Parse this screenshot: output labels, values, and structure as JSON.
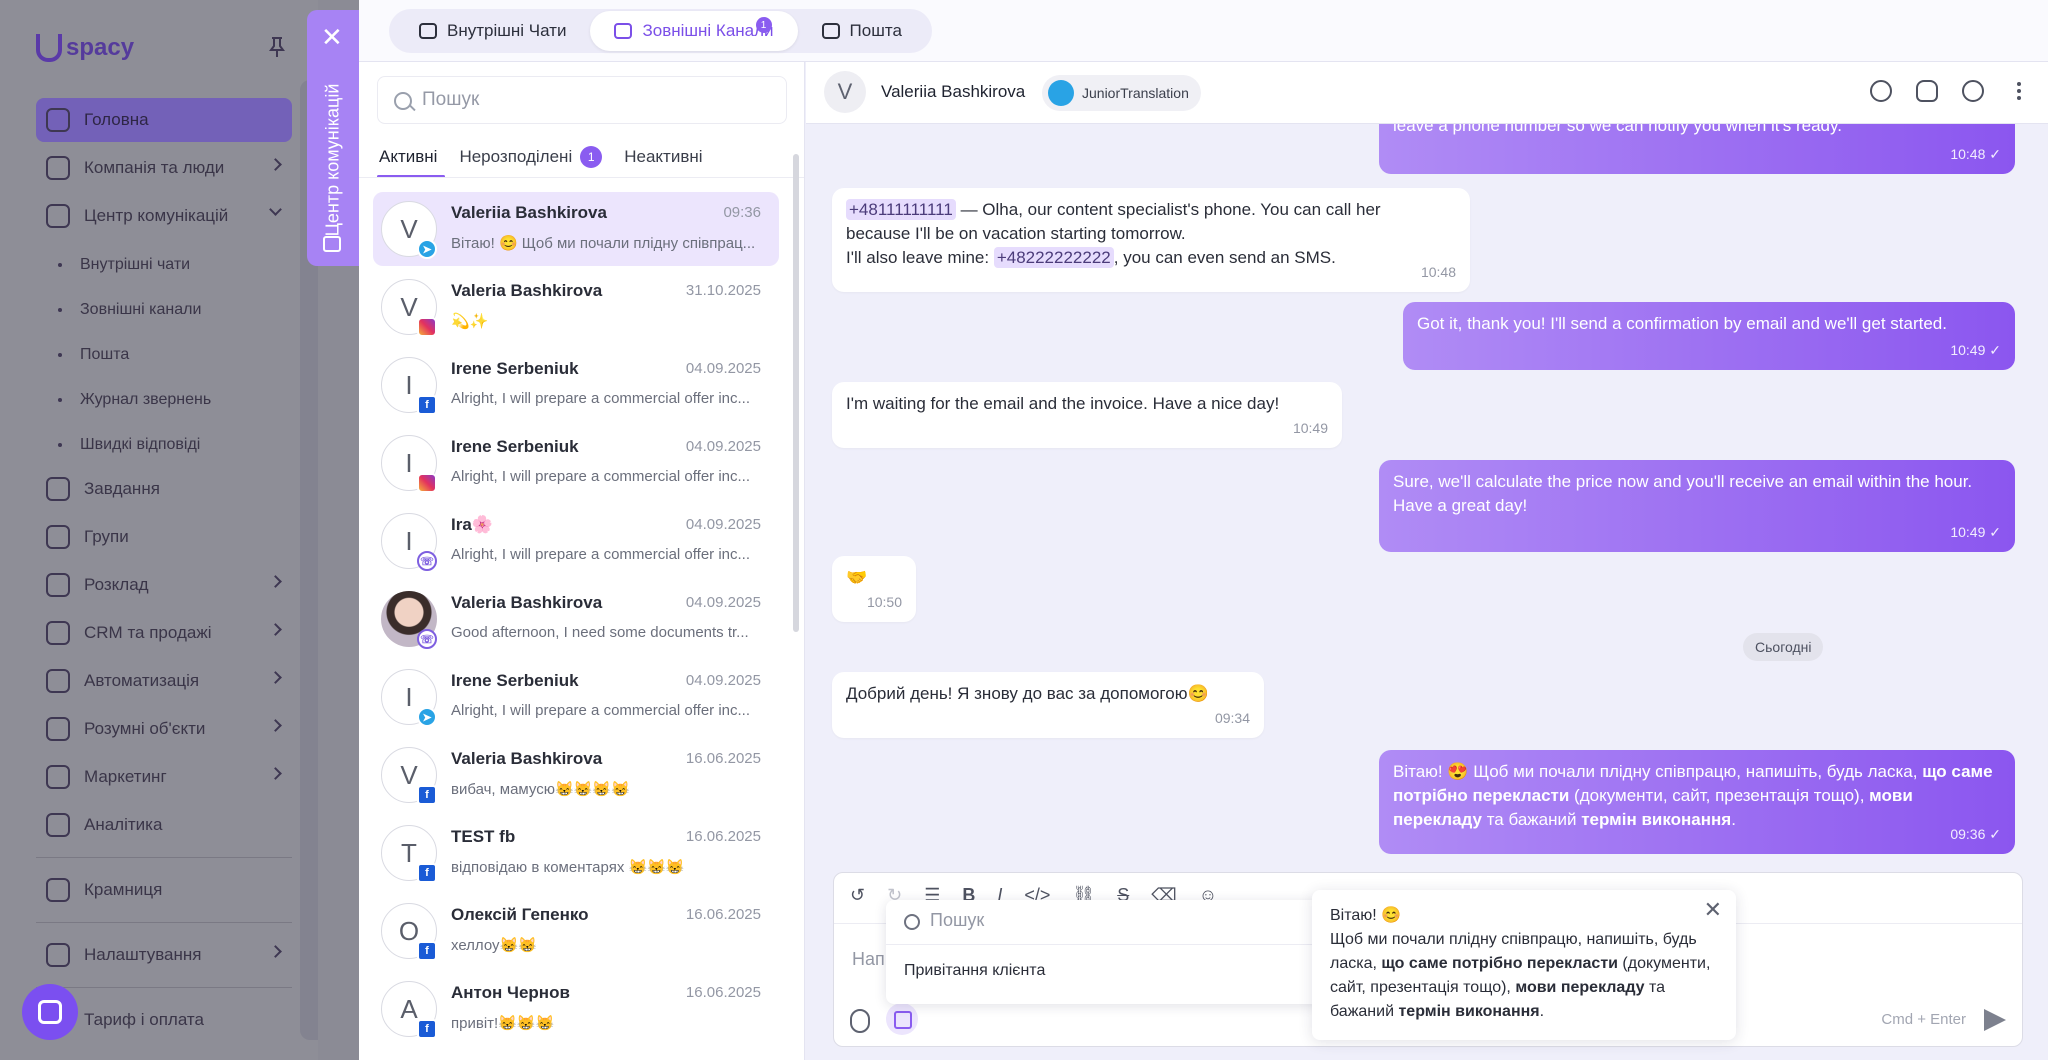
{
  "app": {
    "logo": "spacy"
  },
  "bg_nav": {
    "items": [
      {
        "label": "Головна",
        "active": true
      },
      {
        "label": "Компанія та люди",
        "chev": true
      },
      {
        "label": "Центр комунікацій",
        "chev": true,
        "open": true
      },
      {
        "label": "Завдання"
      },
      {
        "label": "Групи"
      },
      {
        "label": "Розклад",
        "chev": true
      },
      {
        "label": "CRM та продажі",
        "chev": true
      },
      {
        "label": "Автоматизація",
        "chev": true
      },
      {
        "label": "Розумні об'єкти",
        "chev": true
      },
      {
        "label": "Маркетинг",
        "chev": true
      },
      {
        "label": "Аналітика"
      },
      {
        "label": "Крамниця"
      },
      {
        "label": "Налаштування",
        "chev": true
      },
      {
        "label": "Тариф і оплата"
      }
    ],
    "sub": [
      "Внутрішні чати",
      "Зовнішні канали",
      "Пошта",
      "Журнал звернень",
      "Швидкі відповіді"
    ]
  },
  "comm_center": {
    "vertical_title": "Центр комунікацій",
    "close_icon": "close-icon"
  },
  "top_tabs": [
    {
      "label": "Внутрішні Чати",
      "icon": "chat-icon"
    },
    {
      "label": "Зовнішні Канали",
      "icon": "channels-icon",
      "badge": "1"
    },
    {
      "label": "Пошта",
      "icon": "mail-icon"
    }
  ],
  "list": {
    "search_placeholder": "Пошук",
    "tabs": [
      {
        "label": "Активні"
      },
      {
        "label": "Нерозподілені",
        "count": "1"
      },
      {
        "label": "Неактивні"
      }
    ],
    "conversations": [
      {
        "initial": "V",
        "name": "Valeriia Bashkirova",
        "date": "09:36",
        "preview": "Вітаю! 😊 Щоб ми почали плідну співпрац...",
        "channel": "telegram"
      },
      {
        "initial": "V",
        "name": "Valeria Bashkirova",
        "date": "31.10.2025",
        "preview": "💫✨",
        "channel": "instagram"
      },
      {
        "initial": "I",
        "name": "Irene Serbeniuk",
        "date": "04.09.2025",
        "preview": "Alright, I will prepare a commercial offer inc...",
        "channel": "facebook"
      },
      {
        "initial": "I",
        "name": "Irene Serbeniuk",
        "date": "04.09.2025",
        "preview": "Alright, I will prepare a commercial offer inc...",
        "channel": "instagram"
      },
      {
        "initial": "I",
        "name": "Ira🌸",
        "date": "04.09.2025",
        "preview": "Alright, I will prepare a commercial offer inc...",
        "channel": "viber"
      },
      {
        "initial": "",
        "name": "Valeria Bashkirova",
        "date": "04.09.2025",
        "preview": "Good afternoon, I need some documents tr...",
        "channel": "viber",
        "photo": true
      },
      {
        "initial": "I",
        "name": "Irene Serbeniuk",
        "date": "04.09.2025",
        "preview": "Alright, I will prepare a commercial offer inc...",
        "channel": "telegram"
      },
      {
        "initial": "V",
        "name": "Valeria Bashkirova",
        "date": "16.06.2025",
        "preview": "вибач, мамусю😸😸😸😸",
        "channel": "facebook"
      },
      {
        "initial": "T",
        "name": "TEST fb",
        "date": "16.06.2025",
        "preview": "відповідаю в коментарях 😸😸😸",
        "channel": "facebook"
      },
      {
        "initial": "О",
        "name": "Олексій Гепенко",
        "date": "16.06.2025",
        "preview": "хеллоу😸😸",
        "channel": "facebook"
      },
      {
        "initial": "А",
        "name": "Антон Чернов",
        "date": "16.06.2025",
        "preview": "привіт!😸😸😸",
        "channel": "facebook"
      }
    ]
  },
  "chat": {
    "header": {
      "initial": "V",
      "name": "Valeriia Bashkirova",
      "channel_chip": "JuniorTranslation"
    },
    "messages": [
      {
        "dir": "out",
        "text": "leave a phone number so we can notify you when it's ready.",
        "time": "10:48"
      },
      {
        "dir": "in",
        "phone1": "+48111111111",
        "text1": " — Olha, our content specialist's phone. You can call her",
        "text2": "because I'll be on vacation starting tomorrow.",
        "text3": "I'll also leave mine: ",
        "phone2": "+48222222222",
        "text4": ", you can even send an SMS.",
        "time": "10:48"
      },
      {
        "dir": "out",
        "text": "Got it, thank you! I'll send a confirmation by email and we'll get started.",
        "time": "10:49"
      },
      {
        "dir": "in",
        "text": "I'm waiting for the email and the invoice. Have a nice day!",
        "time": "10:49"
      },
      {
        "dir": "out",
        "text": "Sure, we'll calculate the price now and you'll receive an email within the hour. Have a great day!",
        "time": "10:49"
      },
      {
        "dir": "in",
        "text": "🤝",
        "time": "10:50"
      },
      {
        "dir": "in",
        "text": "Добрий день! Я знову до вас за допомогою😊",
        "time": "09:34"
      },
      {
        "dir": "out",
        "p1": "Вітаю! 😍 Щоб ми почали плідну співпрацю, напишіть, будь ласка, ",
        "b1": "що саме потрібно перекласти",
        "p2": " (документи, сайт, презентація тощо), ",
        "b2": "мови перекладу",
        "p3": " та бажаний ",
        "b3": "термін виконання",
        "p4": ".",
        "time": "09:36"
      }
    ],
    "day_label": "Сьогодні"
  },
  "composer": {
    "placeholder": "Нап",
    "send_hint": "Cmd + Enter"
  },
  "quick_replies": {
    "search_placeholder": "Пошук",
    "item": "Привітання клієнта",
    "preview": {
      "line1": "Вітаю!  😊",
      "p1": "Щоб ми почали плідну співпрацю, напишіть, будь ласка, ",
      "b1": "що саме потрібно перекласти",
      "p2": " (документи, сайт, презентація тощо), ",
      "b2": "мови перекладу",
      "p3": " та бажаний ",
      "b3": "термін виконання",
      "p4": "."
    }
  },
  "colors": {
    "accent": "#8a5cf0",
    "outgoing": "#9b6cf2",
    "overlay": "#8b8b95"
  }
}
